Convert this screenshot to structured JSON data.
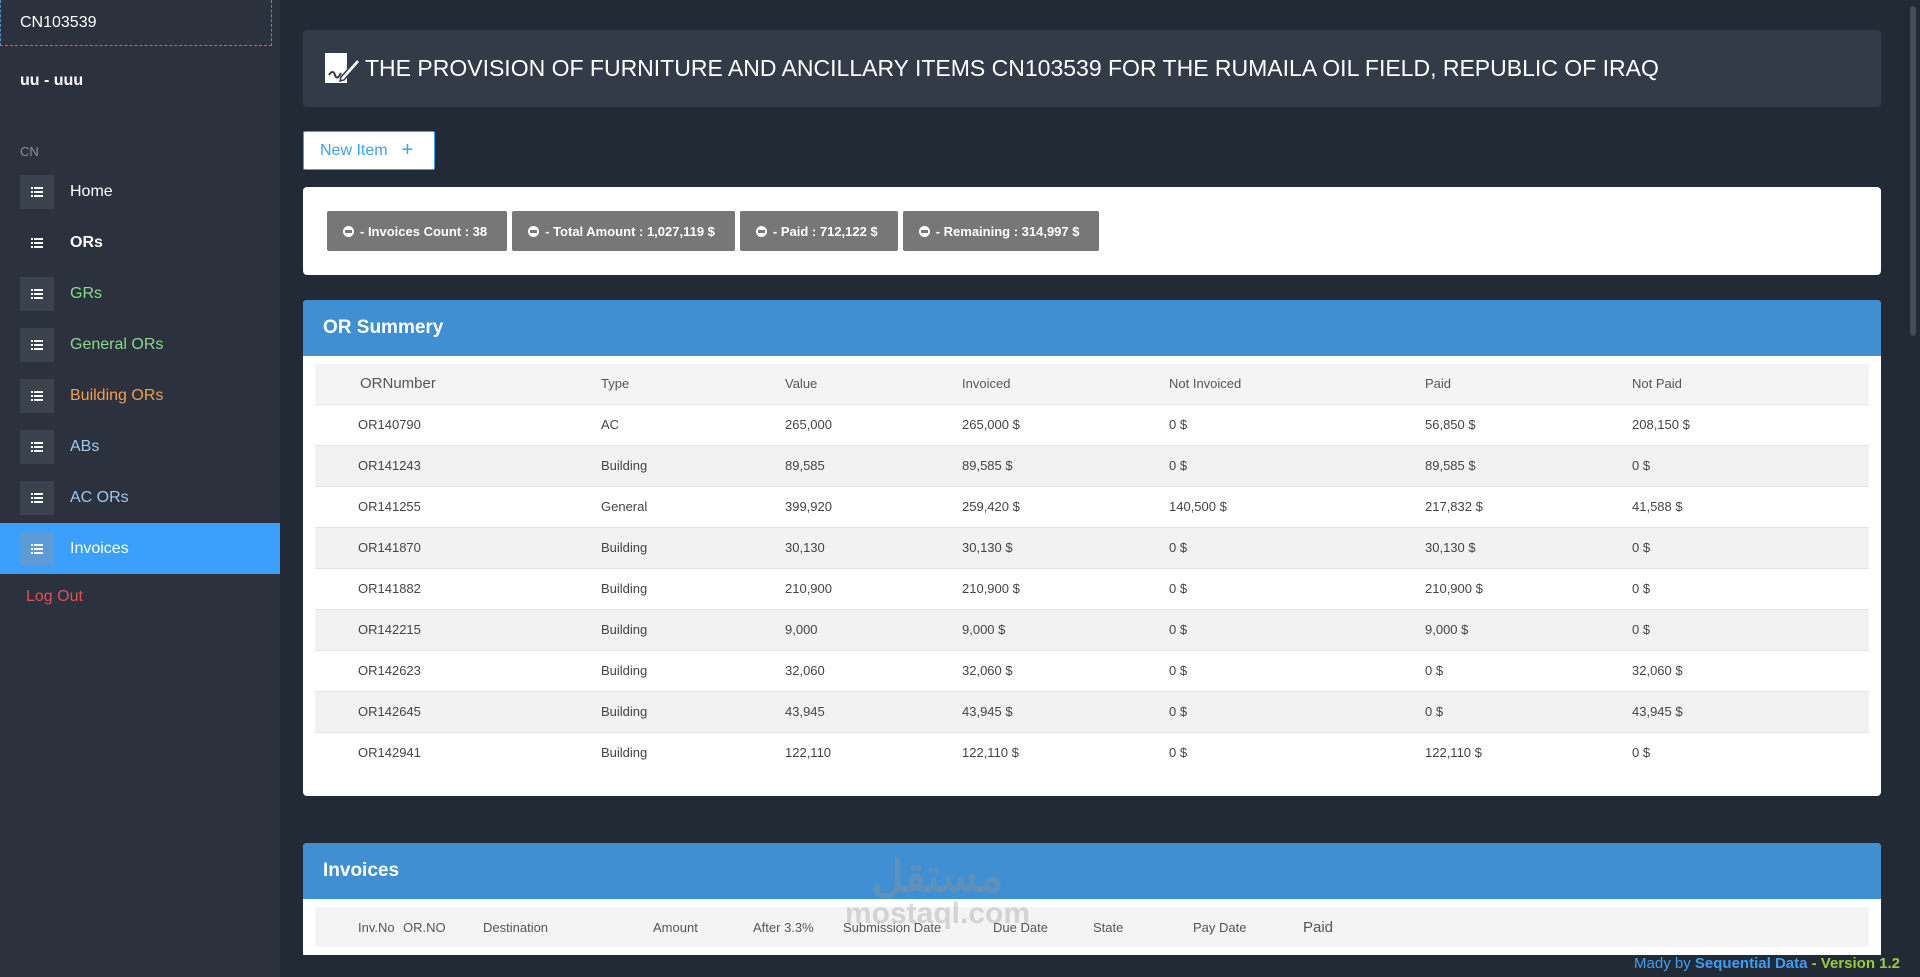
{
  "sidebar": {
    "project_code": "CN103539",
    "user": "uu - uuu",
    "section": "CN",
    "items": [
      {
        "label": "Home",
        "color": "#ffffff"
      },
      {
        "label": "ORs",
        "color": "#ffffff"
      },
      {
        "label": "GRs",
        "color": "#8bd88b"
      },
      {
        "label": "General ORs",
        "color": "#8bd88b"
      },
      {
        "label": "Building ORs",
        "color": "#f0a050"
      },
      {
        "label": "ABs",
        "color": "#9fc8f0"
      },
      {
        "label": "AC ORs",
        "color": "#9fc8f0"
      },
      {
        "label": "Invoices",
        "color": "#ffffff"
      }
    ],
    "logout": "Log Out"
  },
  "header": {
    "title": "THE PROVISION OF FURNITURE AND ANCILLARY ITEMS CN103539 FOR THE RUMAILA OIL FIELD, REPUBLIC OF IRAQ"
  },
  "new_item_label": "New Item",
  "stats": [
    "- Invoices Count : 38",
    "- Total Amount : 1,027,119 $",
    "- Paid : 712,122 $",
    "- Remaining : 314,997 $"
  ],
  "or_summary": {
    "title": "OR Summery",
    "columns": [
      "ORNumber",
      "Type",
      "Value",
      "Invoiced",
      "Not Invoiced",
      "Paid",
      "Not Paid"
    ],
    "rows": [
      [
        "OR140790",
        "AC",
        "265,000",
        "265,000 $",
        "0 $",
        "56,850 $",
        "208,150 $"
      ],
      [
        "OR141243",
        "Building",
        "89,585",
        "89,585 $",
        "0 $",
        "89,585 $",
        "0 $"
      ],
      [
        "OR141255",
        "General",
        "399,920",
        "259,420 $",
        "140,500 $",
        "217,832 $",
        "41,588 $"
      ],
      [
        "OR141870",
        "Building",
        "30,130",
        "30,130 $",
        "0 $",
        "30,130 $",
        "0 $"
      ],
      [
        "OR141882",
        "Building",
        "210,900",
        "210,900 $",
        "0 $",
        "210,900 $",
        "0 $"
      ],
      [
        "OR142215",
        "Building",
        "9,000",
        "9,000 $",
        "0 $",
        "9,000 $",
        "0 $"
      ],
      [
        "OR142623",
        "Building",
        "32,060",
        "32,060 $",
        "0 $",
        "0 $",
        "32,060 $"
      ],
      [
        "OR142645",
        "Building",
        "43,945",
        "43,945 $",
        "0 $",
        "0 $",
        "43,945 $"
      ],
      [
        "OR142941",
        "Building",
        "122,110",
        "122,110 $",
        "0 $",
        "122,110 $",
        "0 $"
      ]
    ]
  },
  "invoices": {
    "title": "Invoices",
    "columns": [
      "Inv.No",
      "OR.NO",
      "Destination",
      "Amount",
      "After 3.3%",
      "Submission Date",
      "Due Date",
      "State",
      "Pay Date",
      "Paid"
    ]
  },
  "watermark": {
    "arabic": "مستقل",
    "latin": "mostaql.com"
  },
  "footer": {
    "made_by": "Mady by",
    "company": "Sequential Data",
    "version": "- Version 1.2"
  }
}
